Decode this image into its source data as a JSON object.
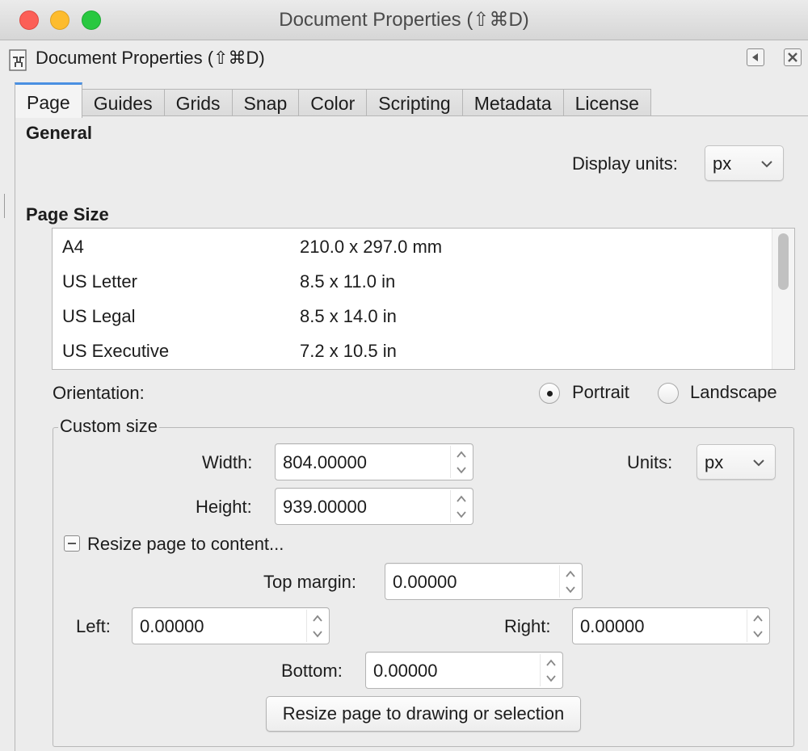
{
  "window": {
    "title": "Document Properties (⇧⌘D)"
  },
  "dock": {
    "title": "Document Properties (⇧⌘D)"
  },
  "tabs": [
    {
      "label": "Page",
      "active": true
    },
    {
      "label": "Guides"
    },
    {
      "label": "Grids"
    },
    {
      "label": "Snap"
    },
    {
      "label": "Color"
    },
    {
      "label": "Scripting"
    },
    {
      "label": "Metadata"
    },
    {
      "label": "License"
    }
  ],
  "general": {
    "heading": "General",
    "display_units_label": "Display units:",
    "display_units_value": "px"
  },
  "page_size": {
    "heading": "Page Size",
    "rows": [
      {
        "name": "A4",
        "size": "210.0 x 297.0 mm"
      },
      {
        "name": "US Letter",
        "size": "8.5 x 11.0 in"
      },
      {
        "name": "US Legal",
        "size": "8.5 x 14.0 in"
      },
      {
        "name": "US Executive",
        "size": "7.2 x 10.5 in"
      }
    ]
  },
  "orientation": {
    "label": "Orientation:",
    "portrait": "Portrait",
    "landscape": "Landscape",
    "selected": "Portrait"
  },
  "custom_size": {
    "title": "Custom size",
    "width_label": "Width:",
    "width_value": "804.00000",
    "height_label": "Height:",
    "height_value": "939.00000",
    "units_label": "Units:",
    "units_value": "px",
    "resize_label": "Resize page to content...",
    "top_margin_label": "Top margin:",
    "top_margin_value": "0.00000",
    "left_label": "Left:",
    "left_value": "0.00000",
    "right_label": "Right:",
    "right_value": "0.00000",
    "bottom_label": "Bottom:",
    "bottom_value": "0.00000",
    "resize_button": "Resize page to drawing or selection"
  },
  "colors": {
    "close": "#fc5f57",
    "minimize": "#fdbc2e",
    "maximize": "#28c840",
    "active_tab_accent": "#4a90e2"
  }
}
